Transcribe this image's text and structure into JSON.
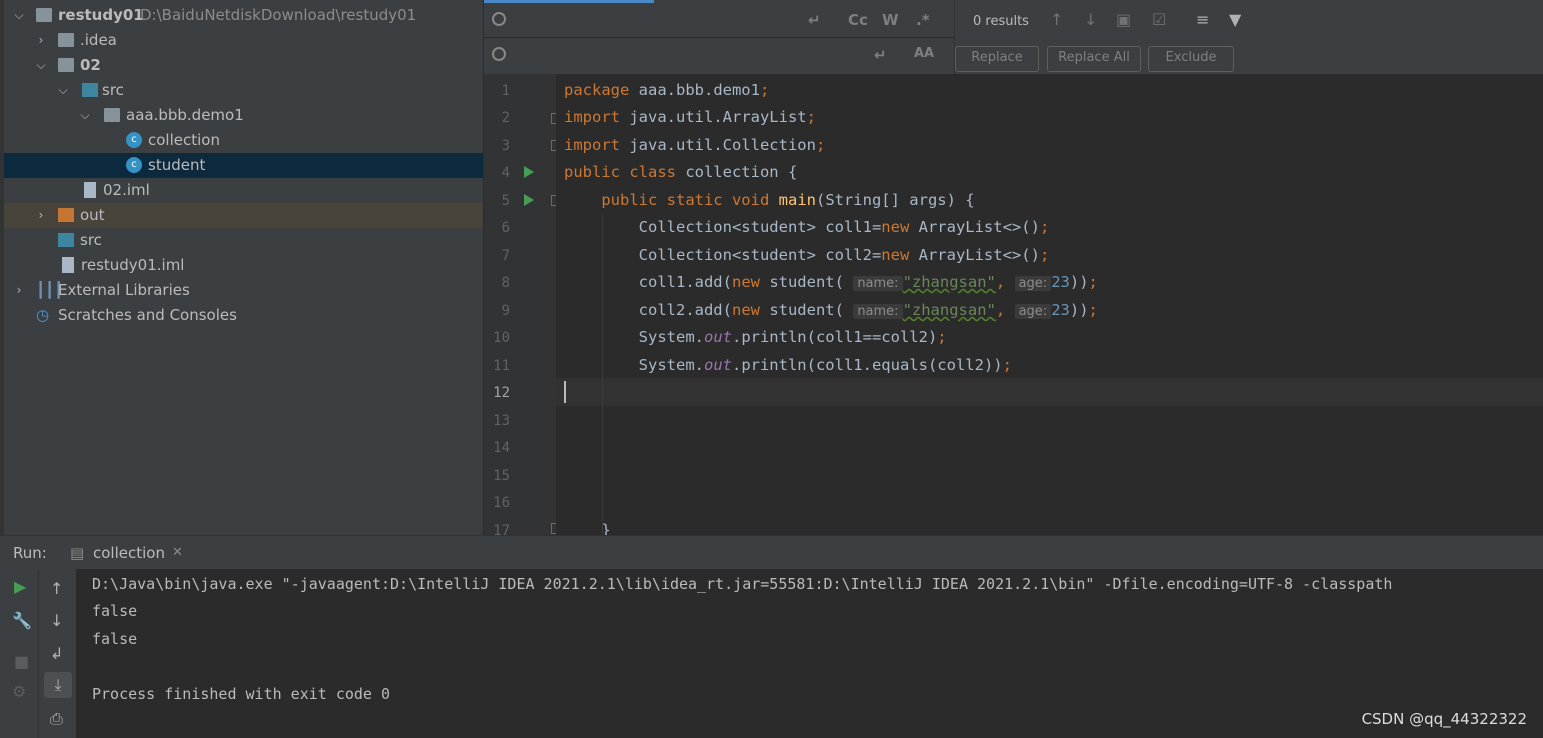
{
  "project_tree": {
    "root": {
      "name": "restudy01",
      "path": "D:\\BaiduNetdiskDownload\\restudy01"
    },
    "items": [
      {
        "label": ".idea"
      },
      {
        "label": "02"
      },
      {
        "label": "src"
      },
      {
        "label": "aaa.bbb.demo1"
      },
      {
        "label": "collection"
      },
      {
        "label": "student"
      },
      {
        "label": "02.iml"
      },
      {
        "label": "out"
      },
      {
        "label": "src"
      },
      {
        "label": "restudy01.iml"
      },
      {
        "label": "External Libraries"
      },
      {
        "label": "Scratches and Consoles"
      }
    ]
  },
  "find_bar": {
    "results": "0 results",
    "match_case": "Cc",
    "words": "W",
    "regex": ".*",
    "replace_btn": "Replace",
    "replace_all_btn": "Replace All",
    "exclude_btn": "Exclude"
  },
  "editor": {
    "line_numbers": [
      "1",
      "2",
      "3",
      "4",
      "5",
      "6",
      "7",
      "8",
      "9",
      "10",
      "11",
      "12",
      "13",
      "14",
      "15",
      "16",
      "17"
    ],
    "current_line": "12",
    "lines": [
      "package aaa.bbb.demo1;",
      "import java.util.ArrayList;",
      "import java.util.Collection;",
      "public class collection {",
      "    public static void main(String[] args) {",
      "        Collection<student> coll1=new ArrayList<>();",
      "        Collection<student> coll2=new ArrayList<>();",
      "        coll1.add(new student( name: \"zhangsan\", age: 23));",
      "        coll2.add(new student( name: \"zhangsan\", age: 23));",
      "        System.out.println(coll1==coll2);",
      "        System.out.println(coll1.equals(coll2));",
      "",
      "",
      "",
      "",
      "",
      "    }"
    ],
    "hints": {
      "name": "name:",
      "age": "age:"
    }
  },
  "run_panel": {
    "label": "Run:",
    "tab": "collection",
    "console": [
      "D:\\Java\\bin\\java.exe \"-javaagent:D:\\IntelliJ IDEA 2021.2.1\\lib\\idea_rt.jar=55581:D:\\IntelliJ IDEA 2021.2.1\\bin\" -Dfile.encoding=UTF-8 -classpath",
      "false",
      "false",
      "",
      "Process finished with exit code 0"
    ]
  },
  "watermark": "CSDN @qq_44322322",
  "colors": {
    "keyword": "#cc7832",
    "string": "#6a8759",
    "number": "#6897bb",
    "method": "#ffc66d",
    "selection": "#0d293e"
  }
}
